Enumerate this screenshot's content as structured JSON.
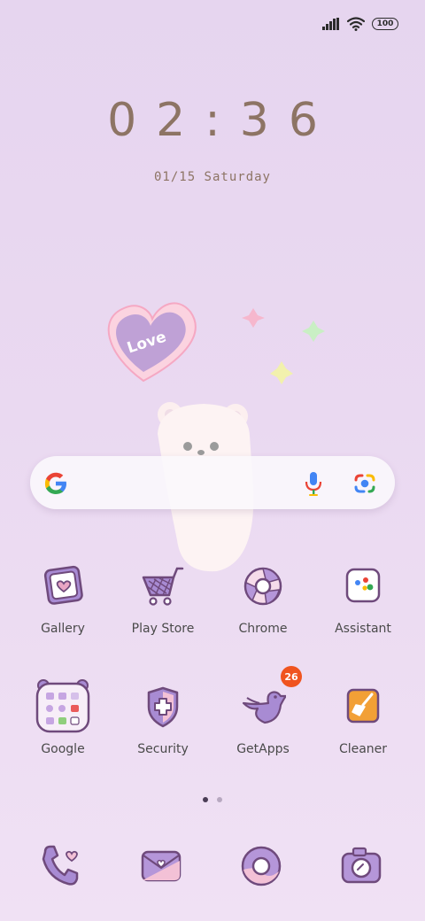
{
  "status": {
    "battery": "100",
    "icons": [
      "signal-icon",
      "wifi-icon",
      "battery-icon"
    ]
  },
  "clock": {
    "time": "02:36",
    "date": "01/15 Saturday"
  },
  "wallpaper": {
    "heart_text": "Love"
  },
  "search": {
    "icons": [
      "google-logo-icon",
      "microphone-icon",
      "lens-camera-icon"
    ]
  },
  "apps": [
    {
      "label": "Gallery",
      "icon": "gallery-icon"
    },
    {
      "label": "Play Store",
      "icon": "shopping-cart-icon"
    },
    {
      "label": "Chrome",
      "icon": "chrome-icon"
    },
    {
      "label": "Assistant",
      "icon": "assistant-icon"
    },
    {
      "label": "Google",
      "icon": "google-folder-icon"
    },
    {
      "label": "Security",
      "icon": "shield-icon"
    },
    {
      "label": "GetApps",
      "icon": "bird-icon",
      "badge": "26"
    },
    {
      "label": "Cleaner",
      "icon": "broom-icon"
    }
  ],
  "pager": {
    "pages": 2,
    "current": 1
  },
  "dock": [
    {
      "icon": "phone-icon"
    },
    {
      "icon": "message-icon"
    },
    {
      "icon": "browser-icon"
    },
    {
      "icon": "camera-icon"
    }
  ],
  "colors": {
    "background": "#e8d7f0",
    "accent_purple": "#9b73c2",
    "outline": "#6f4a7c",
    "badge": "#f0541f"
  }
}
